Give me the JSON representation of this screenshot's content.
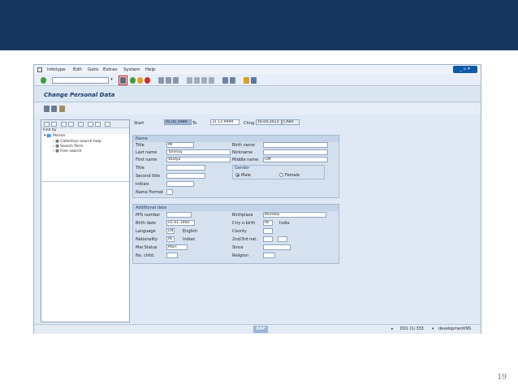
{
  "menu": {
    "items": [
      "Infotype",
      "Edit",
      "Goto",
      "Extras",
      "System",
      "Help"
    ]
  },
  "screen": {
    "title": "Change Personal Data"
  },
  "tree": {
    "find_by": "Find by",
    "person": "Person",
    "items": [
      "Collective search help",
      "Search Term",
      "Free search"
    ]
  },
  "header_fields": {
    "start_label": "Start",
    "start_value": "01.01.1960",
    "to_label": "To",
    "to_value": "31.12.9999",
    "chng_label": "Chng",
    "chng_date": "16.04.2013",
    "chng_user": "CABA"
  },
  "name_group": {
    "title": "Name",
    "title_label": "Title",
    "title_value": "Mr",
    "last_name_label": "Last name",
    "last_name_value": "Tanmay",
    "first_name_label": "First name",
    "first_name_value": "Vaidya",
    "title2_label": "Title",
    "second_title_label": "Second title",
    "initials_label": "Initials",
    "name_format_label": "Name Format",
    "birth_name_label": "Birth name",
    "nickname_label": "Nickname",
    "middle_name_label": "Middle name",
    "middle_name_value": "OM",
    "gender_title": "Gender",
    "male": "Male",
    "female": "Female"
  },
  "additional": {
    "title": "Additional data",
    "pps_label": "PPS number",
    "birth_date_label": "Birth date",
    "birth_date_value": "01.01.1960",
    "language_label": "Language",
    "language_code": "EN",
    "language_text": "English",
    "nationality_label": "Nationality",
    "nationality_code": "IN",
    "nationality_text": "Indian",
    "marstatus_label": "Mar.Status",
    "marstatus_value": "Marr.",
    "nochild_label": "No. child.",
    "birthplace_label": "Birthplace",
    "birthplace_value": "Mumbai",
    "ctry_label": "Ctry o.birth",
    "ctry_code": "IN",
    "ctry_text": "India",
    "county_label": "County",
    "nat2_label": "2nd/3rd nat.",
    "since_label": "Since",
    "religion_label": "Religion"
  },
  "status": {
    "sap": "SAP",
    "system": "D01 (1) 333",
    "server": "development",
    "mode": "INS"
  },
  "slide_number": "19"
}
